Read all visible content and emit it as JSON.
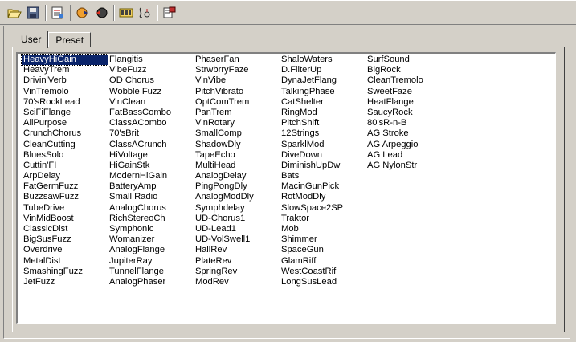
{
  "toolbar": {
    "buttons": [
      {
        "icon": "open-folder-icon"
      },
      {
        "icon": "save-disk-icon"
      },
      {
        "icon": "edit-patch-icon"
      },
      {
        "icon": "send-icon"
      },
      {
        "icon": "receive-icon"
      },
      {
        "icon": "compare-icon"
      },
      {
        "icon": "tuner-icon"
      },
      {
        "icon": "properties-icon"
      }
    ]
  },
  "tabs": [
    {
      "label": "User",
      "active": true
    },
    {
      "label": "Preset",
      "active": false
    }
  ],
  "patches": {
    "selected": "HeavyHiGain",
    "columns": [
      [
        "HeavyHiGain",
        "HeavyTrem",
        "Drivin'Verb",
        "VinTremolo",
        "70'sRockLead",
        "SciFiFlange",
        "AllPurpose",
        "CrunchChorus",
        "CleanCutting",
        "BluesSolo",
        "Cuttin'FI",
        "ArpDelay",
        "FatGermFuzz",
        "BuzzsawFuzz",
        "TubeDrive",
        "VinMidBoost",
        "ClassicDist",
        "BigSusFuzz",
        "Overdrive",
        "MetalDist",
        "SmashingFuzz",
        "JetFuzz"
      ],
      [
        "Flangitis",
        "VibeFuzz",
        "OD Chorus",
        "Wobble Fuzz",
        "VinClean",
        "FatBassCombo",
        "ClassACombo",
        "70'sBrit",
        "ClassACrunch",
        "HiVoltage",
        "HiGainStk",
        "ModernHiGain",
        "BatteryAmp",
        "Small Radio",
        "AnalogChorus",
        "RichStereoCh",
        "Symphonic",
        "Womanizer",
        "AnalogFlange",
        "JupiterRay",
        "TunnelFlange",
        "AnalogPhaser"
      ],
      [
        "PhaserFan",
        "StrwbrryFaze",
        "VinVibe",
        "PitchVibrato",
        "OptComTrem",
        "PanTrem",
        "VinRotary",
        "SmallComp",
        "ShadowDly",
        "TapeEcho",
        "MultiHead",
        "AnalogDelay",
        "PingPongDly",
        "AnalogModDly",
        "Symphdelay",
        "UD-Chorus1",
        "UD-Lead1",
        "UD-VolSwell1",
        "HallRev",
        "PlateRev",
        "SpringRev",
        "ModRev"
      ],
      [
        "ShaloWaters",
        "D.FilterUp",
        "DynaJetFlang",
        "TalkingPhase",
        "CatShelter",
        "RingMod",
        "PitchShift",
        "12Strings",
        "SparklMod",
        "DiveDown",
        "DiminishUpDw",
        "Bats",
        "MacinGunPick",
        "RotModDly",
        "SlowSpace2SP",
        "Traktor",
        "Mob",
        "Shimmer",
        "SpaceGun",
        "GlamRiff",
        "WestCoastRif",
        "LongSusLead"
      ],
      [
        "SurfSound",
        "BigRock",
        "CleanTremolo",
        "SweetFaze",
        "HeatFlange",
        "SaucyRock",
        "80'sR-n-B",
        "AG Stroke",
        "AG Arpeggio",
        "AG Lead",
        "AG NylonStr"
      ]
    ]
  }
}
